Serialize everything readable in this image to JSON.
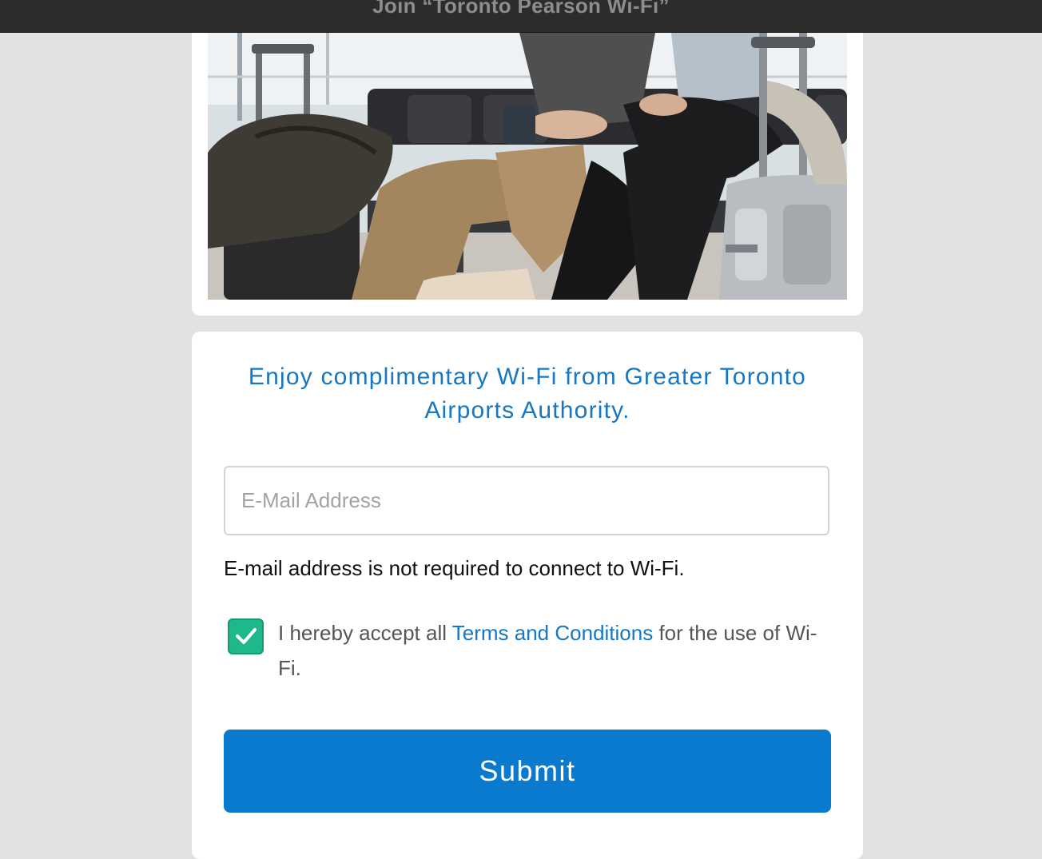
{
  "window": {
    "title": "Join “Toronto Pearson Wi-Fi”"
  },
  "hero": {
    "image": "airport-lounge-travelers-photo"
  },
  "form": {
    "headline": "Enjoy complimentary Wi-Fi from Greater Toronto Airports Authority.",
    "email_placeholder": "E-Mail Address",
    "email_value": "",
    "email_note": "E-mail address is not required to connect to Wi-Fi.",
    "terms_checked": true,
    "terms_prefix": "I hereby accept all ",
    "terms_link": "Terms and Conditions",
    "terms_suffix": " for the use of Wi-Fi.",
    "submit_label": "Submit"
  },
  "colors": {
    "accent": "#0a7ace",
    "link": "#1677c2",
    "checkbox": "#1fb88a",
    "page_background": "#e2e2e2"
  }
}
